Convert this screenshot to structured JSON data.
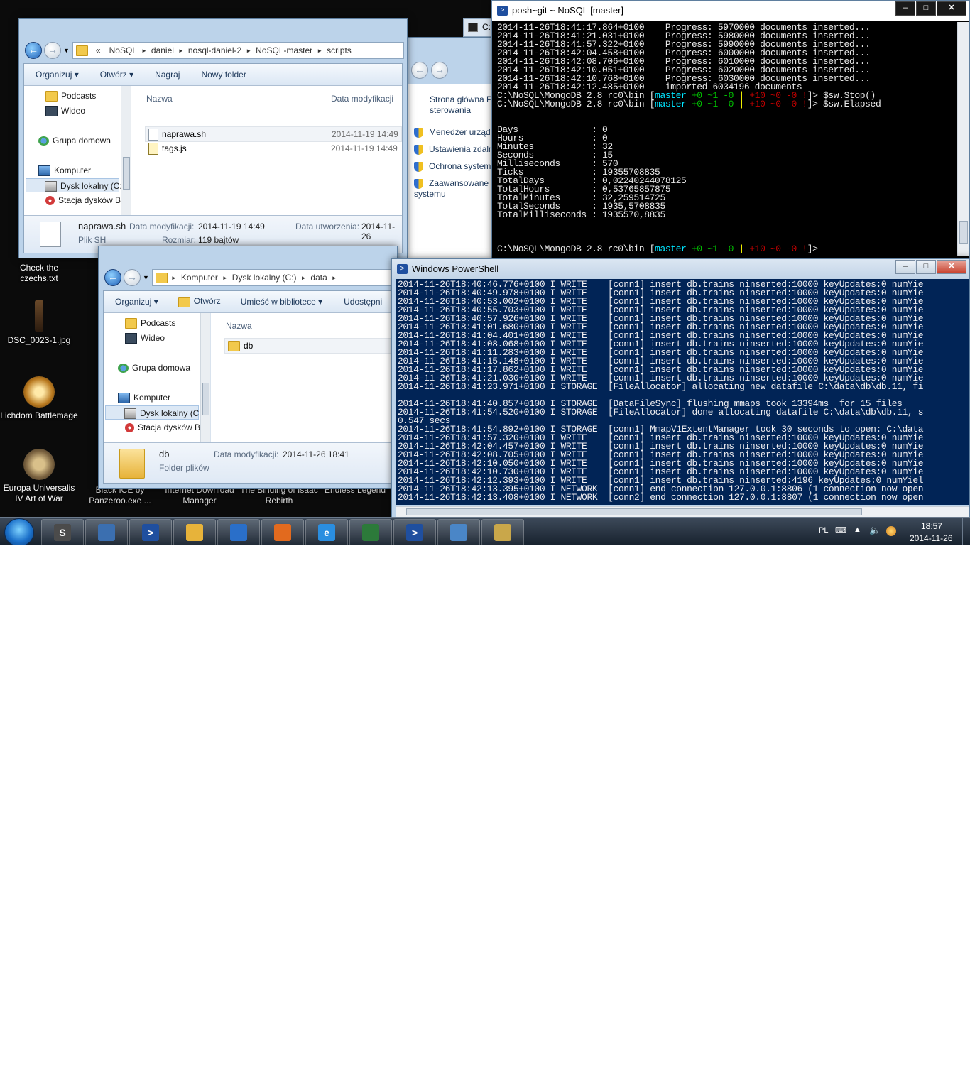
{
  "desktop": {
    "icons": [
      {
        "label": "Check the czechs.txt"
      },
      {
        "label": "DSC_0023-1.jpg"
      },
      {
        "label": "Lichdom Battlemage"
      },
      {
        "label": "Europa Universalis IV Art of War"
      },
      {
        "label": "Black ICE by Panzeroo.exe ..."
      },
      {
        "label": "Internet Download Manager"
      },
      {
        "label": "The Binding of Isaac Rebirth"
      },
      {
        "label": "Endless Legend"
      }
    ]
  },
  "explorer_scripts": {
    "breadcrumb": [
      "«",
      "NoSQL",
      "daniel",
      "nosql-daniel-2",
      "NoSQL-master",
      "scripts"
    ],
    "toolbar": {
      "organize": "Organizuj",
      "open": "Otwórz",
      "burn": "Nagraj",
      "new_folder": "Nowy folder"
    },
    "nav": [
      "Podcasts",
      "Wideo",
      "Grupa domowa",
      "Komputer",
      "Dysk lokalny (C:)",
      "Stacja dysków Bl"
    ],
    "columns": {
      "name": "Nazwa",
      "modified": "Data modyfikacji"
    },
    "files": [
      {
        "name": "naprawa.sh",
        "date": "2014-11-19 14:49",
        "icon": "file-icon"
      },
      {
        "name": "tags.js",
        "date": "2014-11-19 14:49",
        "icon": "script-icon"
      }
    ],
    "details": {
      "name": "naprawa.sh",
      "type": "Plik SH",
      "modified_label": "Data modyfikacji:",
      "modified": "2014-11-19 14:49",
      "created_label": "Data utworzenia:",
      "created": "2014-11-26",
      "size_label": "Rozmiar:",
      "size": "119 bajtów"
    }
  },
  "explorer_data": {
    "breadcrumb": [
      "Komputer",
      "Dysk lokalny (C:)",
      "data"
    ],
    "toolbar": {
      "organize": "Organizuj",
      "open": "Otwórz",
      "library": "Umieść w bibliotece",
      "share": "Udostępni"
    },
    "nav": [
      "Podcasts",
      "Wideo",
      "Grupa domowa",
      "Komputer",
      "Dysk lokalny (C:)",
      "Stacja dysków Bl"
    ],
    "columns": {
      "name": "Nazwa"
    },
    "files": [
      {
        "name": "db"
      }
    ],
    "details": {
      "name": "db",
      "type": "Folder plików",
      "modified_label": "Data modyfikacji:",
      "modified": "2014-11-26 18:41"
    }
  },
  "control_panel": {
    "home": "Strona główna P sterowania",
    "links": [
      "Menedżer urządz",
      "Ustawienia zdaln",
      "Ochrona system",
      "Zaawansowane systemu"
    ]
  },
  "small_window_title": "C:",
  "posh_git": {
    "title": "posh~git ~ NoSQL [master]",
    "lines": [
      "2014-11-26T18:41:17.864+0100    Progress: 5970000 documents inserted...",
      "2014-11-26T18:41:21.031+0100    Progress: 5980000 documents inserted...",
      "2014-11-26T18:41:57.322+0100    Progress: 5990000 documents inserted...",
      "2014-11-26T18:42:04.458+0100    Progress: 6000000 documents inserted...",
      "2014-11-26T18:42:08.706+0100    Progress: 6010000 documents inserted...",
      "2014-11-26T18:42:10.051+0100    Progress: 6020000 documents inserted...",
      "2014-11-26T18:42:10.768+0100    Progress: 6030000 documents inserted...",
      "2014-11-26T18:42:12.485+0100    imported 6034196 documents"
    ],
    "prompt_path": "C:\\NoSQL\\MongoDB 2.8 rc0\\bin ",
    "prompt_branch": "master",
    "prompt_stat1": " +0 ~1 -0 ",
    "prompt_pipe": "|",
    "prompt_stat2": " +10 ~0 -0 !",
    "prompt_end": "]> ",
    "commands": [
      "$sw.Stop()",
      "$sw.Elapsed"
    ],
    "elapsed": [
      "Days              : 0",
      "Hours             : 0",
      "Minutes           : 32",
      "Seconds           : 15",
      "Milliseconds      : 570",
      "Ticks             : 19355708835",
      "TotalDays         : 0,02240244078125",
      "TotalHours        : 0,53765857875",
      "TotalMinutes      : 32,259514725",
      "TotalSeconds      : 1935,5708835",
      "TotalMilliseconds : 1935570,8835"
    ]
  },
  "powershell": {
    "title": "Windows PowerShell",
    "lines": [
      "2014-11-26T18:40:46.776+0100 I WRITE    [conn1] insert db.trains ninserted:10000 keyUpdates:0 numYie",
      "2014-11-26T18:40:49.978+0100 I WRITE    [conn1] insert db.trains ninserted:10000 keyUpdates:0 numYie",
      "2014-11-26T18:40:53.002+0100 I WRITE    [conn1] insert db.trains ninserted:10000 keyUpdates:0 numYie",
      "2014-11-26T18:40:55.703+0100 I WRITE    [conn1] insert db.trains ninserted:10000 keyUpdates:0 numYie",
      "2014-11-26T18:40:57.926+0100 I WRITE    [conn1] insert db.trains ninserted:10000 keyUpdates:0 numYie",
      "2014-11-26T18:41:01.680+0100 I WRITE    [conn1] insert db.trains ninserted:10000 keyUpdates:0 numYie",
      "2014-11-26T18:41:04.401+0100 I WRITE    [conn1] insert db.trains ninserted:10000 keyUpdates:0 numYie",
      "2014-11-26T18:41:08.068+0100 I WRITE    [conn1] insert db.trains ninserted:10000 keyUpdates:0 numYie",
      "2014-11-26T18:41:11.283+0100 I WRITE    [conn1] insert db.trains ninserted:10000 keyUpdates:0 numYie",
      "2014-11-26T18:41:15.148+0100 I WRITE    [conn1] insert db.trains ninserted:10000 keyUpdates:0 numYie",
      "2014-11-26T18:41:17.862+0100 I WRITE    [conn1] insert db.trains ninserted:10000 keyUpdates:0 numYie",
      "2014-11-26T18:41:21.030+0100 I WRITE    [conn1] insert db.trains ninserted:10000 keyUpdates:0 numYie",
      "2014-11-26T18:41:23.971+0100 I STORAGE  [FileAllocator] allocating new datafile C:\\data\\db\\db.11, fi",
      "",
      "2014-11-26T18:41:40.857+0100 I STORAGE  [DataFileSync] flushing mmaps took 13394ms  for 15 files",
      "2014-11-26T18:41:54.520+0100 I STORAGE  [FileAllocator] done allocating datafile C:\\data\\db\\db.11, s",
      "0.547 secs",
      "2014-11-26T18:41:54.892+0100 I STORAGE  [conn1] MmapV1ExtentManager took 30 seconds to open: C:\\data",
      "2014-11-26T18:41:57.320+0100 I WRITE    [conn1] insert db.trains ninserted:10000 keyUpdates:0 numYie",
      "2014-11-26T18:42:04.457+0100 I WRITE    [conn1] insert db.trains ninserted:10000 keyUpdates:0 numYie",
      "2014-11-26T18:42:08.705+0100 I WRITE    [conn1] insert db.trains ninserted:10000 keyUpdates:0 numYie",
      "2014-11-26T18:42:10.050+0100 I WRITE    [conn1] insert db.trains ninserted:10000 keyUpdates:0 numYie",
      "2014-11-26T18:42:10.730+0100 I WRITE    [conn1] insert db.trains ninserted:10000 keyUpdates:0 numYie",
      "2014-11-26T18:42:12.393+0100 I WRITE    [conn1] insert db.trains ninserted:4196 keyUpdates:0 numYiel",
      "2014-11-26T18:42:13.395+0100 I NETWORK  [conn1] end connection 127.0.0.1:8806 (1 connection now open",
      "2014-11-26T18:42:13.408+0100 I NETWORK  [conn2] end connection 127.0.0.1:8807 (1 connection now open"
    ]
  },
  "taskbar": {
    "apps": [
      "sublime-text-icon",
      "keepass-icon",
      "powershell-icon",
      "explorer-icon",
      "thunderbird-icon",
      "firefox-icon",
      "internet-explorer-icon",
      "task-manager-icon",
      "powershell-icon",
      "control-panel-icon",
      "paint-icon"
    ],
    "language": "PL",
    "time": "18:57",
    "date": "2014-11-26"
  },
  "colors": {
    "ps_blue": "#012456",
    "console_black": "#000000",
    "prompt_cyan": "#00e5ff",
    "prompt_green": "#00c000",
    "prompt_yellow": "#ffff00",
    "prompt_red": "#c00000"
  }
}
